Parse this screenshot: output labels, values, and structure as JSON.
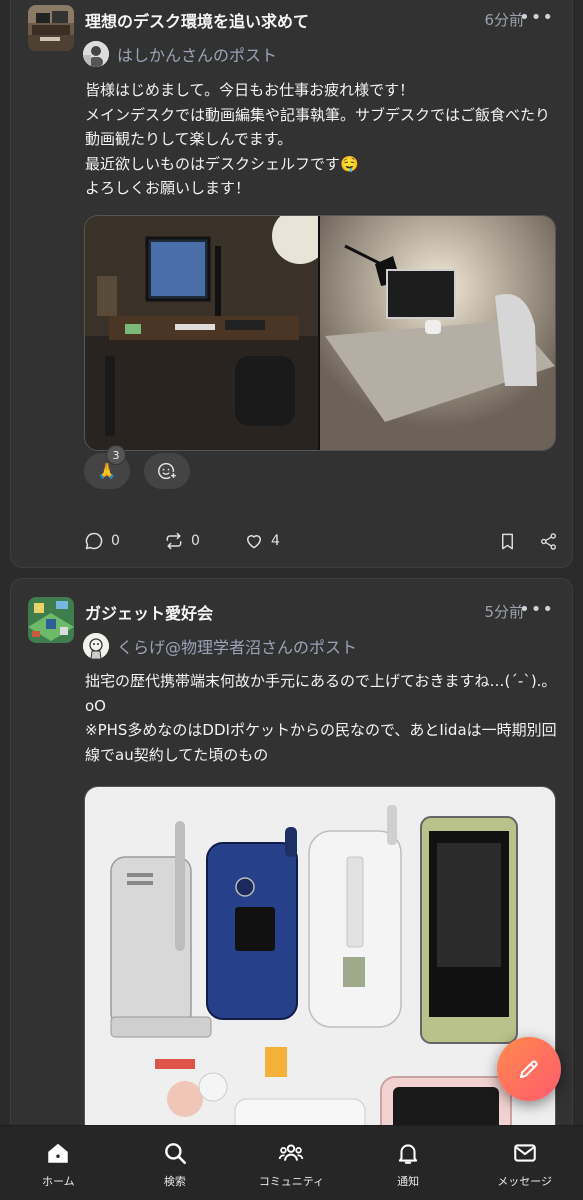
{
  "posts": [
    {
      "community": "理想のデスク環境を追い求めて",
      "time": "6分前",
      "more": "•••",
      "author": "はしかんさんのポスト",
      "text_lines": [
        "皆様はじめまして。今日もお仕事お疲れ様です！",
        "メインデスクでは動画編集や記事執筆。サブデスクではご飯食べたり動画観たりして楽しんでます。",
        "最近欲しいものはデスクシェルフです🤤",
        "よろしくお願いします！"
      ],
      "reaction_emoji": "🙏",
      "reaction_count": "3",
      "comments": "0",
      "reposts": "0",
      "likes": "4"
    },
    {
      "community": "ガジェット愛好会",
      "time": "5分前",
      "more": "•••",
      "author": "くらげ@物理学者沼さんのポスト",
      "text_lines": [
        "拙宅の歴代携帯端末何故か手元にあるので上げておきますね…(´-`).｡oO",
        "※PHS多めなのはDDIポケットからの民なので、あとIidaは一時期別回線でau契約してた頃のもの"
      ]
    }
  ],
  "nav": [
    {
      "label": "ホーム",
      "icon": "home-icon"
    },
    {
      "label": "検索",
      "icon": "search-icon"
    },
    {
      "label": "コミュニティ",
      "icon": "community-icon"
    },
    {
      "label": "通知",
      "icon": "bell-icon"
    },
    {
      "label": "メッセージ",
      "icon": "mail-icon"
    }
  ],
  "colors": {
    "background": "#2b2b2b",
    "card": "#323232",
    "muted": "#9aa0ad",
    "fab_start": "#ff8a4c",
    "fab_end": "#ff5a6e"
  }
}
